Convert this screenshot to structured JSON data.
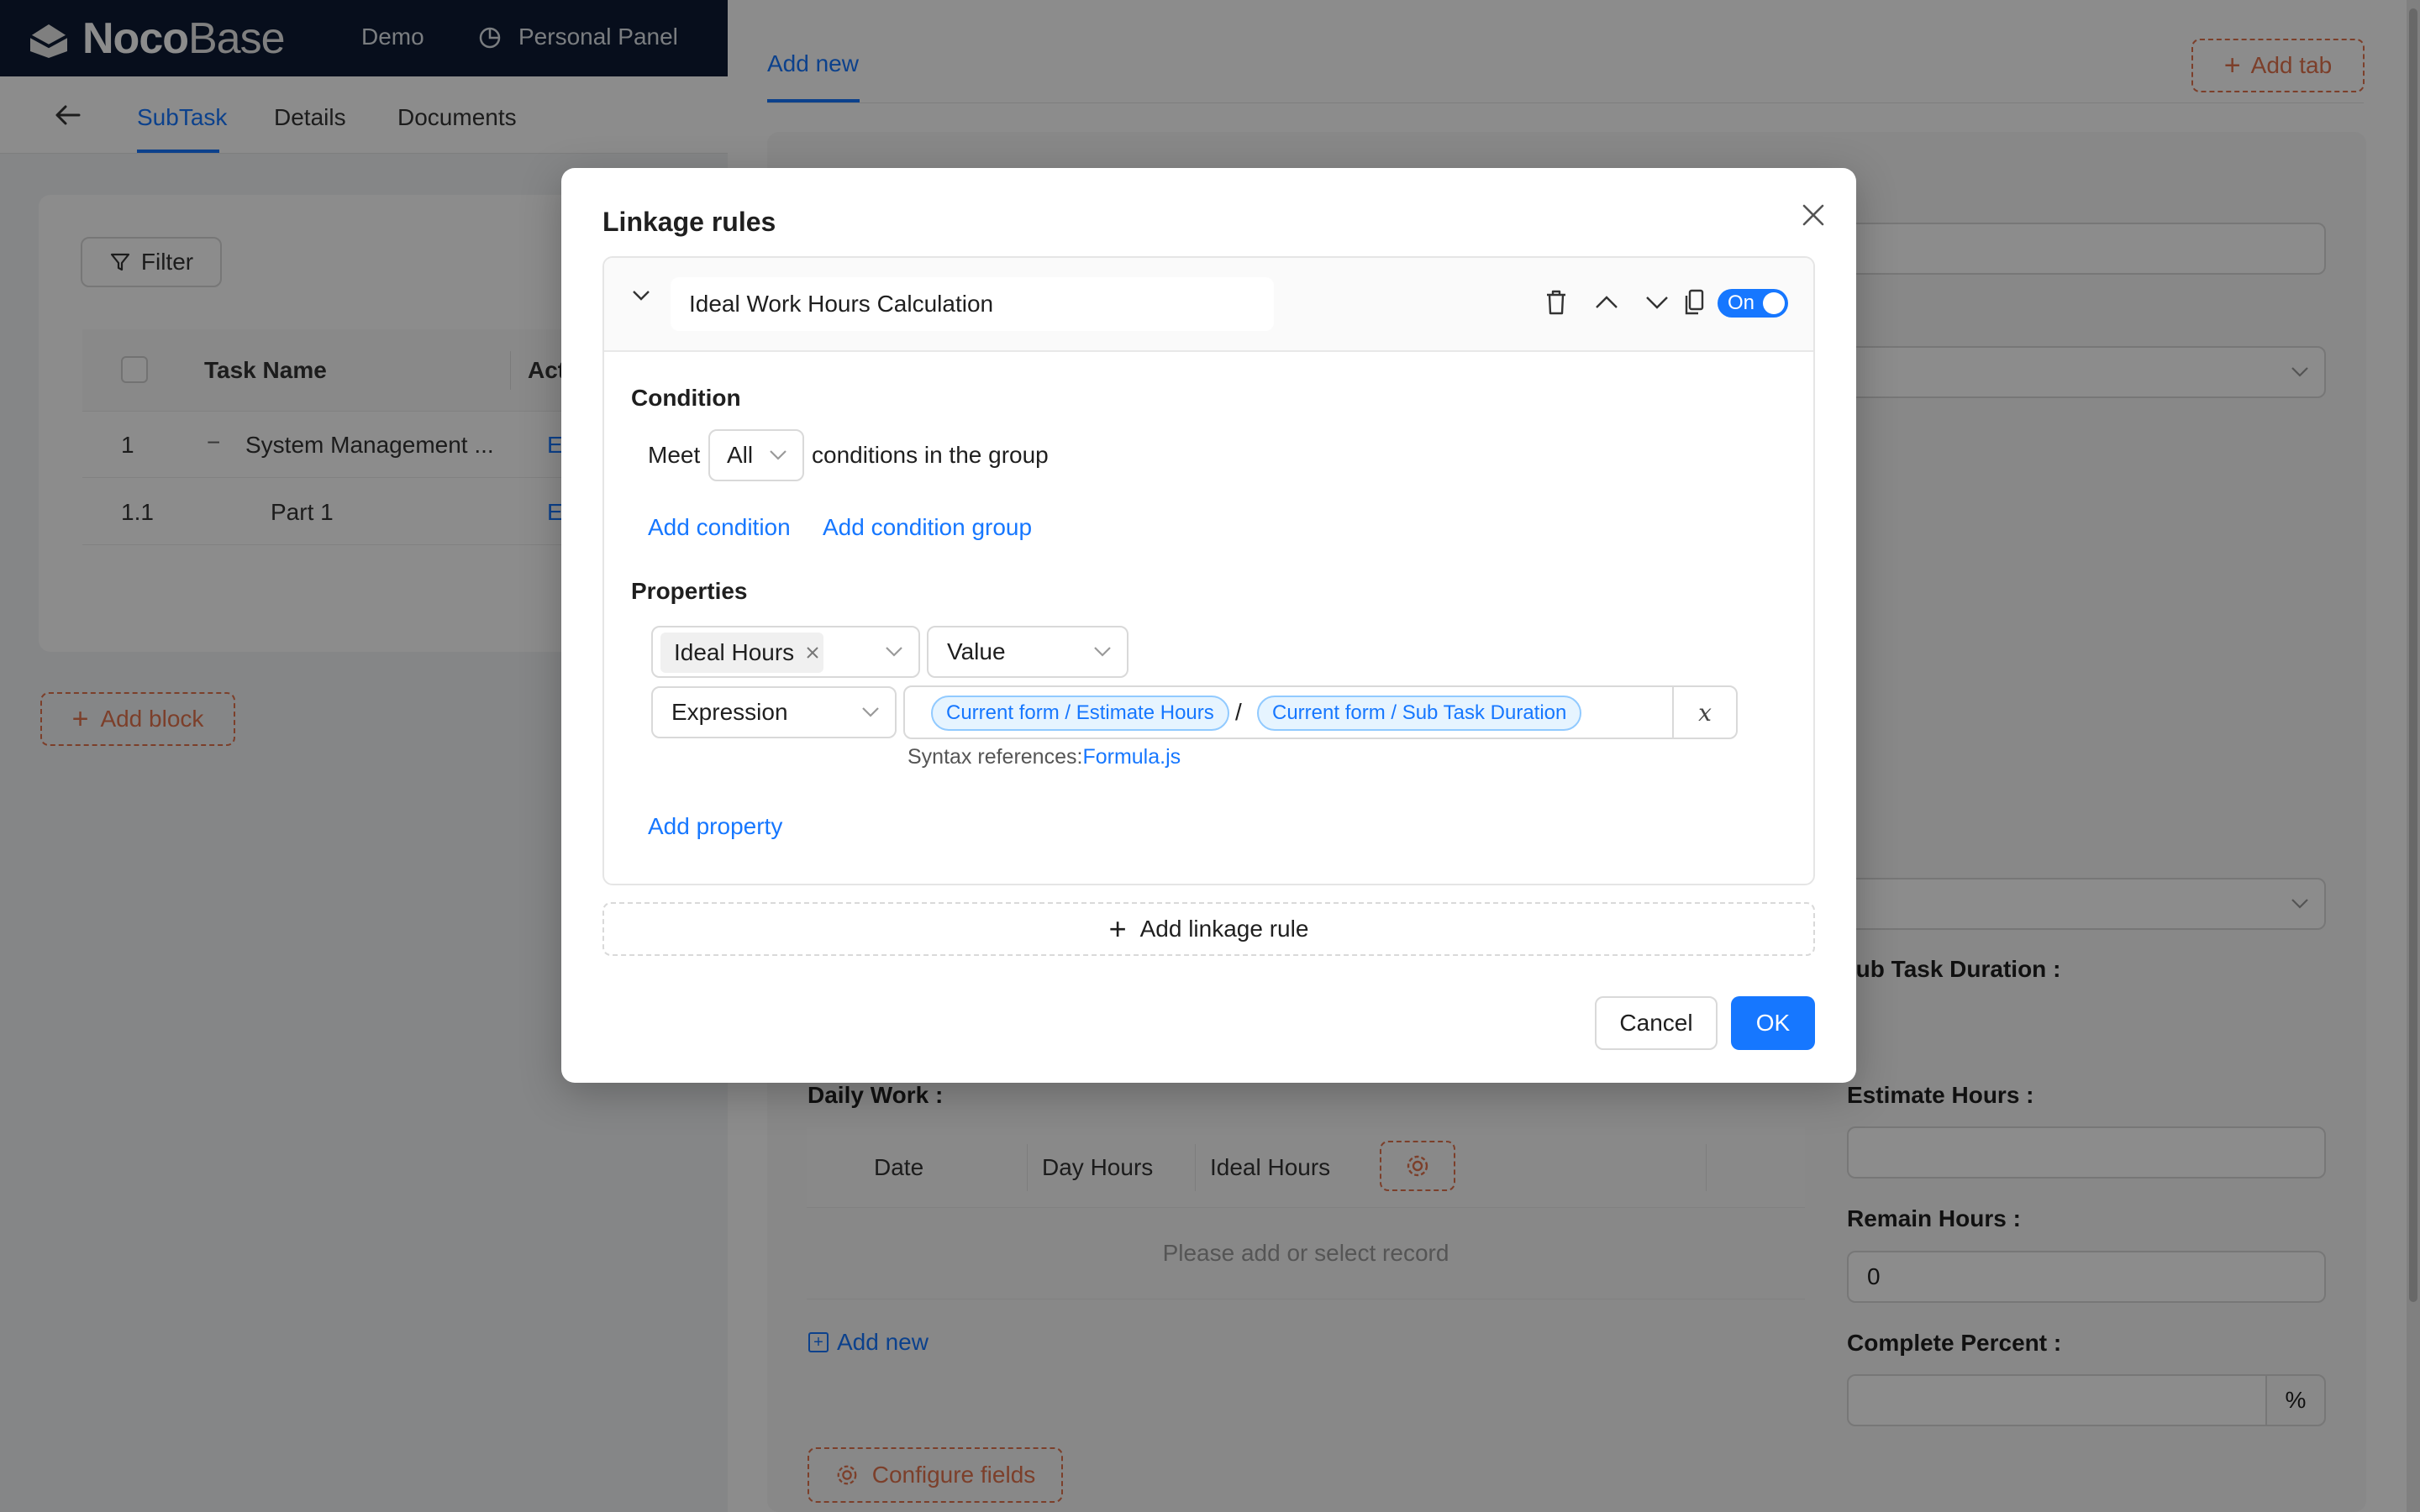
{
  "app": {
    "logo_noco": "Noco",
    "logo_base": "Base",
    "nav": [
      "Demo",
      "Personal Panel"
    ]
  },
  "subtabs": [
    "SubTask",
    "Details",
    "Documents"
  ],
  "left_table": {
    "filter_label": "Filter",
    "headers": [
      "Task Name",
      "Act"
    ],
    "rows": [
      {
        "index": "1",
        "toggle": "−",
        "name": "System Management ...",
        "action": "E"
      },
      {
        "index": "1.1",
        "toggle": "",
        "name": "Part 1",
        "action": "E"
      }
    ],
    "add_block_label": "Add block"
  },
  "drawer": {
    "tab_label": "Add new",
    "add_tab_label": "Add tab",
    "labels": {
      "sub_task_duration": "Sub Task Duration :",
      "daily_work": "Daily Work :",
      "estimate_hours": "Estimate Hours :",
      "remain_hours": "Remain Hours :",
      "complete_percent": "Complete Percent :"
    },
    "remain_hours_value": "0",
    "percent_suffix": "%",
    "daily_columns": [
      "Date",
      "Day Hours",
      "Ideal Hours"
    ],
    "empty_text": "Please add or select record",
    "add_new_label": "Add new",
    "configure_fields_label": "Configure fields"
  },
  "modal": {
    "title": "Linkage rules",
    "rule": {
      "name": "Ideal Work Hours Calculation",
      "toggle_label": "On",
      "toggle_on": true
    },
    "condition": {
      "title": "Condition",
      "meet_label": "Meet",
      "meet_value": "All",
      "suffix": "conditions in the group",
      "add_condition": "Add condition",
      "add_condition_group": "Add condition group"
    },
    "properties": {
      "title": "Properties",
      "field_tag": "Ideal Hours",
      "action_value": "Value",
      "mode_value": "Expression",
      "expression_vars": [
        "Current form / Estimate Hours",
        "Current form / Sub Task Duration"
      ],
      "expression_operator": "/",
      "syntax_prefix": "Syntax references:",
      "syntax_link": "Formula.js",
      "x_button": "x",
      "add_property": "Add property"
    },
    "add_linkage_rule": "Add linkage rule",
    "cancel_label": "Cancel",
    "ok_label": "OK"
  },
  "icons": {
    "close": "close-icon",
    "delete": "trash-icon",
    "move_up": "chevron-up-icon",
    "move_down": "chevron-down-icon",
    "copy": "copy-icon",
    "back": "arrow-left-icon",
    "filter": "filter-icon",
    "gear": "gear-icon",
    "plus": "plus-icon"
  },
  "colors": {
    "primary": "#1677ff",
    "accent_orange": "#e2734e",
    "topbar": "#0d1b33"
  }
}
